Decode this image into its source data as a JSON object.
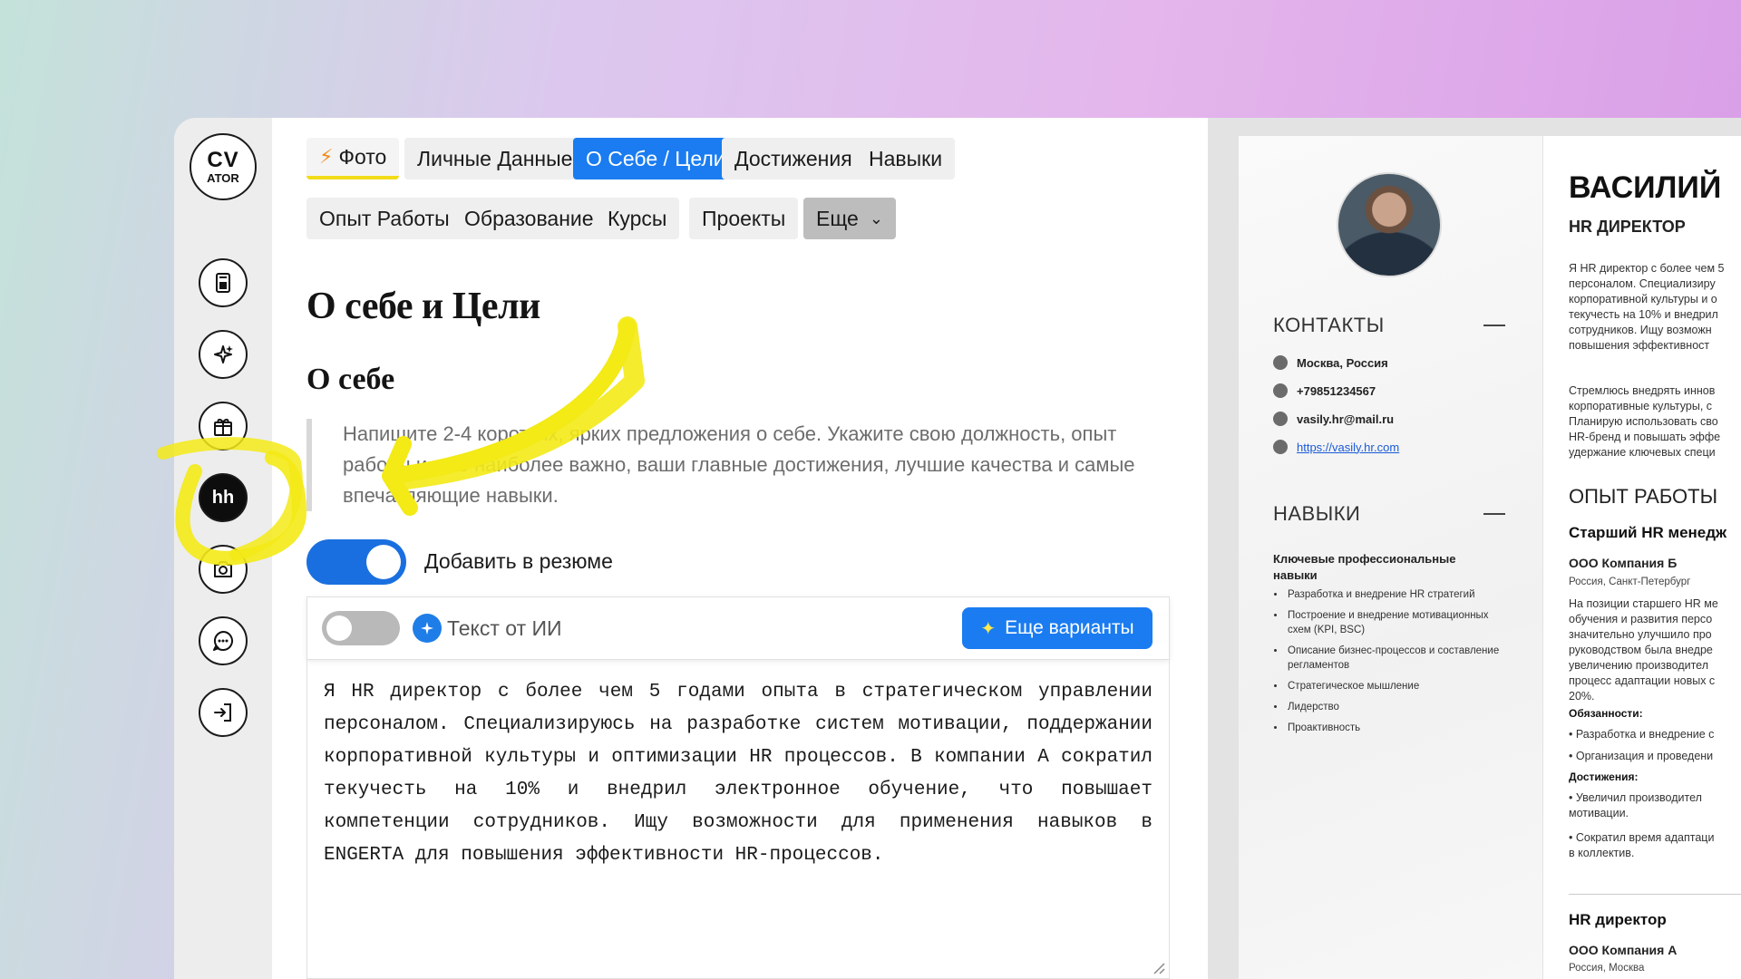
{
  "sidebar": {
    "logo_top": "CV",
    "logo_bottom": "ATOR",
    "hh_label": "hh",
    "buttons": [
      "resume-icon",
      "sparkle-icon",
      "gift-icon",
      "hh-button",
      "camera-icon",
      "chat-icon",
      "logout-icon"
    ]
  },
  "tabs": {
    "photo": "Фото",
    "personal": "Личные Данные",
    "about": "О Себе / Цели",
    "achievements": "Достижения",
    "skills": "Навыки",
    "experience": "Опыт Работы",
    "education": "Образование",
    "courses": "Курсы",
    "projects": "Проекты",
    "more": "Еще"
  },
  "editor": {
    "title": "О себе и Цели",
    "subtitle": "О себе",
    "hint": "Напишите 2-4 коротких, ярких предложения о себе. Укажите свою должность, опыт работы и, что наиболее важно, ваши главные достижения, лучшие качества и самые впечатляющие навыки.",
    "add_to_resume_label": "Добавить в резюме",
    "add_to_resume_on": true,
    "ai_text_label": "Текст от ИИ",
    "ai_text_on": false,
    "more_variants_label": "Еще варианты",
    "about_text": "Я HR директор с более чем 5 годами опыта в стратегическом управлении персоналом. Специализируюсь на разработке систем мотивации, поддержании корпоративной культуры и оптимизации HR процессов. В компании А сократил текучесть на 10% и внедрил электронное обучение, что повышает компетенции сотрудников. Ищу возможности для применения навыков в ENGERTA для повышения эффективности HR-процессов."
  },
  "resume": {
    "contacts_title": "КОНТАКТЫ",
    "location": "Москва, Россия",
    "phone": "+79851234567",
    "email": "vasily.hr@mail.ru",
    "website": "https://vasily.hr.com",
    "skills_title": "НАВЫКИ",
    "skills_group": "Ключевые профессиональные навыки",
    "skills": [
      "Разработка и внедрение HR стратегий",
      "Построение и внедрение мотивационных схем (KPI, BSC)",
      "Описание бизнес-процессов и составление регламентов",
      "Стратегическое мышление",
      "Лидерство",
      "Проактивность"
    ],
    "name": "ВАСИЛИЙ",
    "position": "HR ДИРЕКТОР",
    "summary_1": "Я HR директор с более чем 5\nперсоналом. Специализиру\nкорпоративной культуры и о\nтекучесть на 10% и внедрил\nсотрудников. Ищу возможн\nповышения эффективност",
    "summary_2": "Стремлюсь внедрять иннов\nкорпоративные культуры, с\nПланирую использовать сво\nHR-бренд и повышать эффе\nудержание ключевых специ",
    "experience_title": "ОПЫТ РАБОТЫ",
    "job1_title": "Старший HR менедж",
    "job1_company": "ООО Компания Б",
    "job1_location": "Россия, Санкт-Петербург",
    "job1_desc": "На позиции старшего HR ме\nобучения и развития персо\nзначительно улучшило про\nруководством была внедре\nувеличению производител\nпроцесс адаптации новых с\n20%.",
    "duties_label": "Обязанности:",
    "duty_1": "Разработка и внедрение с",
    "duty_2": "Организация и проведени",
    "achievements_label": "Достижения:",
    "ach_1": "Увеличил производител\nмотивации.",
    "ach_2": "Сократил время адаптаци\nв коллектив.",
    "job2_title": "HR директор",
    "job2_company": "ООО Компания А",
    "job2_location": "Россия, Москва"
  }
}
